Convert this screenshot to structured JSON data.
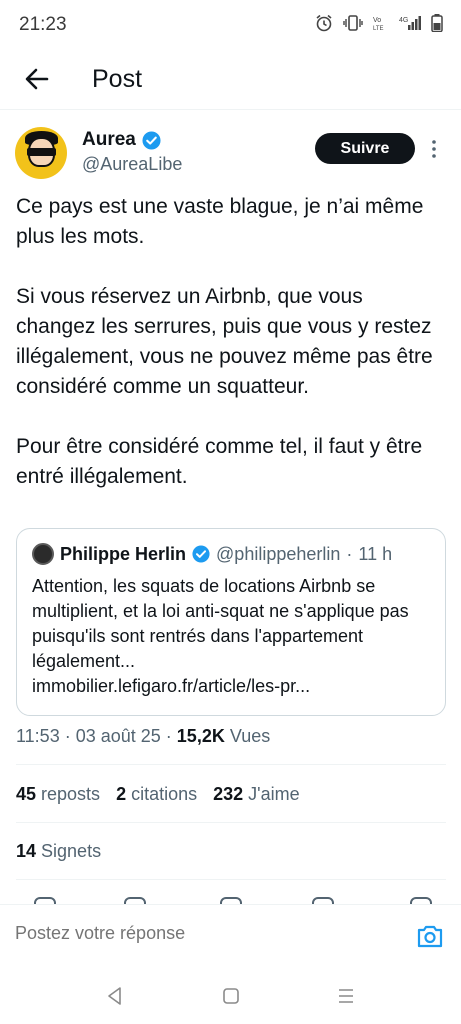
{
  "status_bar": {
    "time": "21:23",
    "icons": [
      "alarm-icon",
      "vibrate-icon",
      "volte-icon",
      "signal-icon",
      "battery-icon"
    ]
  },
  "header": {
    "title": "Post",
    "back_icon": "arrow-left-icon"
  },
  "author": {
    "name": "Aurea",
    "handle": "@AureaLibe",
    "verified": true,
    "follow_label": "Suivre"
  },
  "tweet": {
    "paragraphs": [
      "Ce pays est une vaste blague, je n’ai même plus les mots.",
      "Si vous réservez un Airbnb, que vous changez les serrures, puis que vous y restez illégalement, vous ne pouvez même pas être considéré comme un squatteur.",
      "Pour être considéré comme tel, il faut y être entré illégalement."
    ]
  },
  "quote": {
    "name": "Philippe Herlin",
    "handle": "@philippeherlin",
    "separator": "·",
    "time": "11 h",
    "text": "Attention, les squats de locations Airbnb se multiplient, et la loi anti-squat ne s'applique pas puisqu'ils sont rentrés dans l'appartement légalement...",
    "link": "immobilier.lefigaro.fr/article/les-pr..."
  },
  "meta": {
    "time": "11:53",
    "date": "03 août 25",
    "views_count": "15,2K",
    "views_label": "Vues"
  },
  "stats": {
    "reposts_count": "45",
    "reposts_label": "reposts",
    "quotes_count": "2",
    "quotes_label": "citations",
    "likes_count": "232",
    "likes_label": "J'aime"
  },
  "bookmarks": {
    "count": "14",
    "label": "Signets"
  },
  "reply": {
    "placeholder": "Postez votre réponse"
  },
  "colors": {
    "text": "#0f1419",
    "secondary": "#536471",
    "verified": "#1d9bf0",
    "border": "#cfd9de"
  }
}
